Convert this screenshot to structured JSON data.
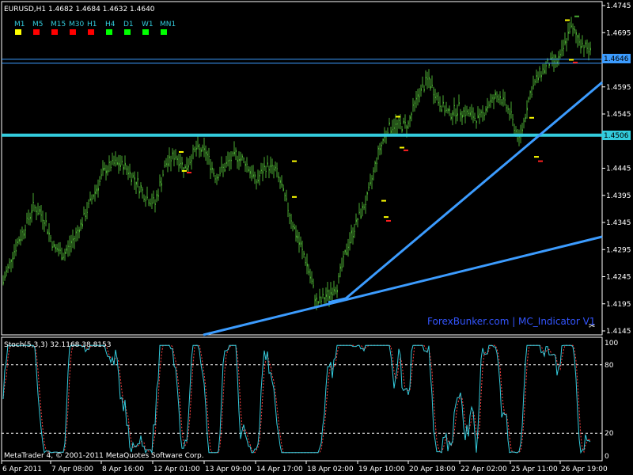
{
  "header": {
    "symbol_line": "EURUSD,H1  1.4682 1.4684 1.4632 1.4640"
  },
  "timeframes": [
    {
      "label": "M1",
      "color": "#ffff00"
    },
    {
      "label": "M5",
      "color": "#ff0000"
    },
    {
      "label": "M15",
      "color": "#ff0000"
    },
    {
      "label": "M30",
      "color": "#ff0000"
    },
    {
      "label": "H1",
      "color": "#ff0000"
    },
    {
      "label": "H4",
      "color": "#00ff00"
    },
    {
      "label": "D1",
      "color": "#00ff00"
    },
    {
      "label": "W1",
      "color": "#00ff00"
    },
    {
      "label": "MN1",
      "color": "#00ff00"
    }
  ],
  "colors": {
    "background": "#000000",
    "candle": "#4aa832",
    "trendline": "#3c9cff",
    "support_line": "#33ccdd",
    "stoch_main": "#33ccdd",
    "stoch_signal": "#ff4040",
    "axis_text": "#ffffff",
    "tf_label": "#33ccdd",
    "watermark": "#3355ff"
  },
  "price_labels": {
    "current": "1.4646",
    "level": "1.4506"
  },
  "watermark": "ForexBunker.com | MC_Indicator V1",
  "stoch_header": "Stoch(5,3,3) 32.1168 38.8153",
  "copyright": "MetaTrader 4, © 2001-2011 MetaQuotes Software Corp.",
  "chart_data": {
    "type": "candlestick",
    "symbol": "EURUSD",
    "timeframe": "H1",
    "ylim": [
      1.4145,
      1.4745
    ],
    "y_ticks": [
      "1.4745",
      "1.4695",
      "1.4646",
      "1.4595",
      "1.4545",
      "1.4506",
      "1.4445",
      "1.4395",
      "1.4345",
      "1.4295",
      "1.4245",
      "1.4195",
      "1.4145"
    ],
    "x_ticks": [
      "6 Apr 2011",
      "7 Apr 08:00",
      "8 Apr 16:00",
      "12 Apr 01:00",
      "13 Apr 09:00",
      "14 Apr 17:00",
      "18 Apr 02:00",
      "19 Apr 10:00",
      "20 Apr 18:00",
      "22 Apr 02:00",
      "25 Apr 11:00",
      "26 Apr 19:00"
    ],
    "close_path": [
      1.4235,
      1.429,
      1.433,
      1.4375,
      1.4355,
      1.43,
      1.4285,
      1.4315,
      1.4355,
      1.44,
      1.444,
      1.4455,
      1.445,
      1.4425,
      1.4395,
      1.438,
      1.445,
      1.447,
      1.4445,
      1.448,
      1.4475,
      1.443,
      1.445,
      1.447,
      1.4455,
      1.442,
      1.445,
      1.444,
      1.438,
      1.432,
      1.427,
      1.4195,
      1.421,
      1.423,
      1.43,
      1.435,
      1.439,
      1.447,
      1.452,
      1.4525,
      1.4525,
      1.458,
      1.461,
      1.457,
      1.4545,
      1.4555,
      1.4545,
      1.4535,
      1.4565,
      1.458,
      1.455,
      1.4495,
      1.458,
      1.462,
      1.464,
      1.4645,
      1.4705,
      1.468,
      1.466
    ],
    "levels": [
      1.4646,
      1.4506
    ],
    "stochastic": {
      "params": "5,3,3",
      "main": 32.1168,
      "signal": 38.8153,
      "ylim": [
        0,
        100
      ],
      "levels": [
        80,
        20
      ],
      "ticks": [
        "100",
        "80",
        "20",
        "0"
      ]
    }
  }
}
